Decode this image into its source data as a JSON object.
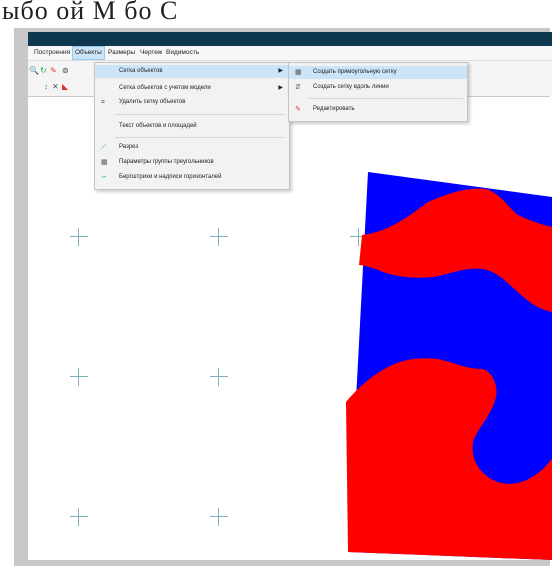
{
  "background_text": "ыбо                   ой               М          бо   С",
  "menu": {
    "items": [
      "Построения",
      "Объекты",
      "Размеры",
      "Чертеж",
      "Видимость"
    ]
  },
  "objects_menu": {
    "items": [
      {
        "label": "Сетка объектов",
        "icon": "",
        "submenu": true
      },
      {
        "label": "Сетка объектов с учетом модели",
        "icon": "",
        "submenu": true
      },
      {
        "label": "Удалить сетку объектов",
        "icon": "delete-grid-icon",
        "submenu": false
      },
      {
        "label": "Текст объектов и площадей",
        "icon": "",
        "submenu": false
      },
      {
        "label": "Разрез",
        "icon": "section-icon",
        "submenu": false
      },
      {
        "label": "Параметры группы треугольников",
        "icon": "triangle-params-icon",
        "submenu": false
      },
      {
        "label": "Бергштрихи и надписи горизонталей",
        "icon": "contour-labels-icon",
        "submenu": false
      }
    ]
  },
  "grid_submenu": {
    "items": [
      {
        "label": "Создать прямоугольную сетку",
        "icon": "rect-grid-icon"
      },
      {
        "label": "Создать сетку вдоль линии",
        "icon": "line-grid-icon"
      },
      {
        "label": "Редактировать",
        "icon": "edit-icon"
      }
    ]
  },
  "colors": {
    "titlebar": "#0d3850",
    "map_red": "#ff0000",
    "map_blue": "#0000ff",
    "highlight": "#cce4f7",
    "grid_cross": "#7fb2ba"
  }
}
